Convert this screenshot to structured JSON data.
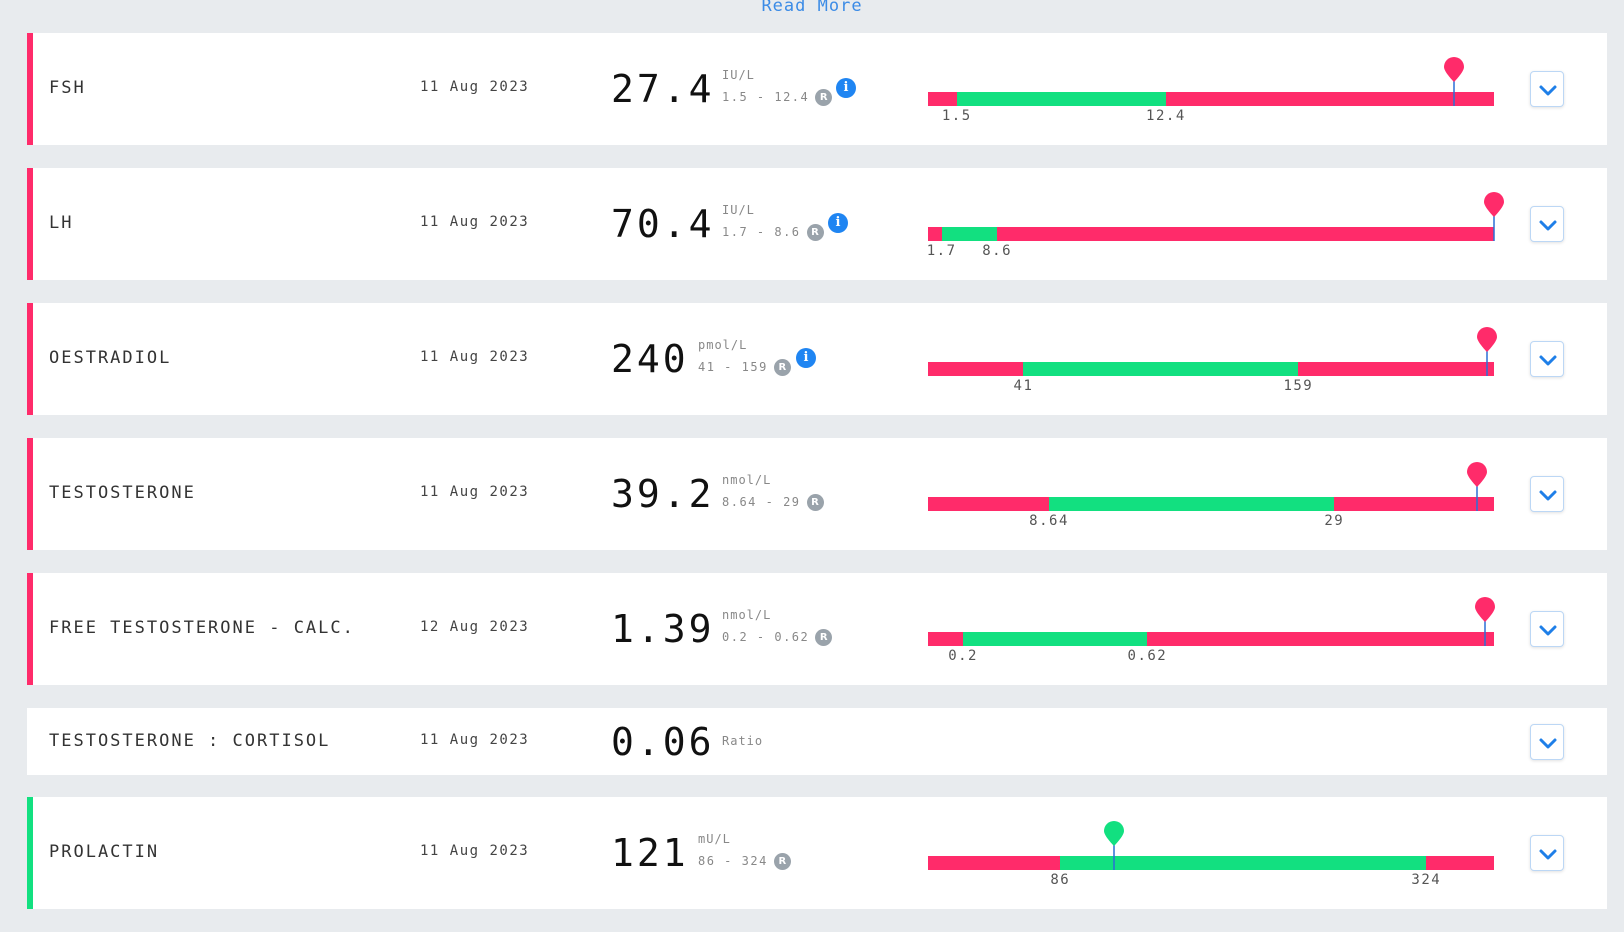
{
  "read_more": "Read More",
  "colors": {
    "high": "#ff2b6a",
    "normal": "#12e080",
    "info": "#1f85f2",
    "link": "#3b8be6"
  },
  "results": [
    {
      "name": "FSH",
      "date": "11 Aug 2023",
      "value": "27.4",
      "unit": "IU/L",
      "range": "1.5 - 12.4",
      "range_badge": "R",
      "info": true,
      "status": "high",
      "scale": {
        "min": 0.0,
        "max": 29.5
      },
      "low": 1.5,
      "high": 12.4,
      "low_label": "1.5",
      "high_label": "12.4",
      "marker": 27.4
    },
    {
      "name": "LH",
      "date": "11 Aug 2023",
      "value": "70.4",
      "unit": "IU/L",
      "range": "1.7 - 8.6",
      "range_badge": "R",
      "info": true,
      "status": "high",
      "scale": {
        "min": 0.0,
        "max": 70.4
      },
      "low": 1.7,
      "high": 8.6,
      "low_label": "1.7",
      "high_label": "8.6",
      "marker": 70.4
    },
    {
      "name": "OESTRADIOL",
      "date": "11 Aug 2023",
      "value": "240",
      "unit": "pmol/L",
      "range": "41 - 159",
      "range_badge": "R",
      "info": true,
      "status": "high",
      "scale": {
        "min": 0,
        "max": 243
      },
      "low": 41,
      "high": 159,
      "low_label": "41",
      "high_label": "159",
      "marker": 240
    },
    {
      "name": "TESTOSTERONE",
      "date": "11 Aug 2023",
      "value": "39.2",
      "unit": "nmol/L",
      "range": "8.64 - 29",
      "range_badge": "R",
      "info": false,
      "status": "high",
      "scale": {
        "min": 0,
        "max": 40.4
      },
      "low": 8.64,
      "high": 29,
      "low_label": "8.64",
      "high_label": "29",
      "marker": 39.2
    },
    {
      "name": "FREE TESTOSTERONE - CALC.",
      "date": "12 Aug 2023",
      "value": "1.39",
      "unit": "nmol/L",
      "range": "0.2 - 0.62",
      "range_badge": "R",
      "info": false,
      "status": "high",
      "scale": {
        "min": 0.12,
        "max": 1.41
      },
      "low": 0.2,
      "high": 0.62,
      "low_label": "0.2",
      "high_label": "0.62",
      "marker": 1.39
    },
    {
      "name": "TESTOSTERONE : CORTISOL",
      "date": "11 Aug 2023",
      "value": "0.06",
      "unit": "Ratio",
      "range": "",
      "range_badge": "",
      "info": false,
      "status": "none"
    },
    {
      "name": "PROLACTIN",
      "date": "11 Aug 2023",
      "value": "121",
      "unit": "mU/L",
      "range": "86 - 324",
      "range_badge": "R",
      "info": false,
      "status": "normal",
      "scale": {
        "min": 0,
        "max": 368
      },
      "low": 86,
      "high": 324,
      "low_label": "86",
      "high_label": "324",
      "marker": 121
    }
  ]
}
